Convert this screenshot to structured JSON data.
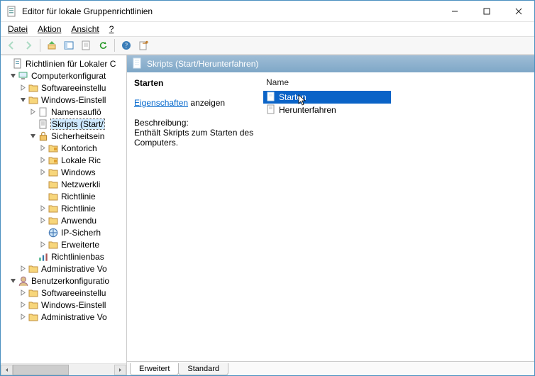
{
  "window": {
    "title": "Editor für lokale Gruppenrichtlinien"
  },
  "menu": {
    "file": "Datei",
    "action": "Aktion",
    "view": "Ansicht",
    "help": "?"
  },
  "tree": {
    "root": "Richtlinien für Lokaler C",
    "computer": "Computerkonfigurat",
    "softwareC": "Softwareeinstellu",
    "windowsC": "Windows-Einstell",
    "nameres": "Namensauflö",
    "scripts": "Skripts (Start/",
    "security": "Sicherheitsein",
    "konto": "Kontorich",
    "lokale": "Lokale Ric",
    "winfw": "Windows",
    "netzwerk": "Netzwerkli",
    "richtl1": "Richtlinie",
    "richtl2": "Richtlinie",
    "anwend": "Anwendu",
    "ipsec": "IP-Sicherh",
    "erweit": "Erweiterte",
    "richtlbasis": "Richtlinienbas",
    "adminC": "Administrative Vo",
    "user": "Benutzerkonfiguratio",
    "softwareU": "Softwareeinstellu",
    "windowsU": "Windows-Einstell",
    "adminU": "Administrative Vo"
  },
  "pane": {
    "header": "Skripts (Start/Herunterfahren)",
    "selectedTitle": "Starten",
    "propsLink": "Eigenschaften",
    "propsSuffix": " anzeigen",
    "descLabel": "Beschreibung:",
    "descText": "Enthält Skripts zum Starten des Computers.",
    "columnName": "Name",
    "items": {
      "start": "Starten",
      "shutdown": "Herunterfahren"
    }
  },
  "tabs": {
    "extended": "Erweitert",
    "standard": "Standard"
  }
}
